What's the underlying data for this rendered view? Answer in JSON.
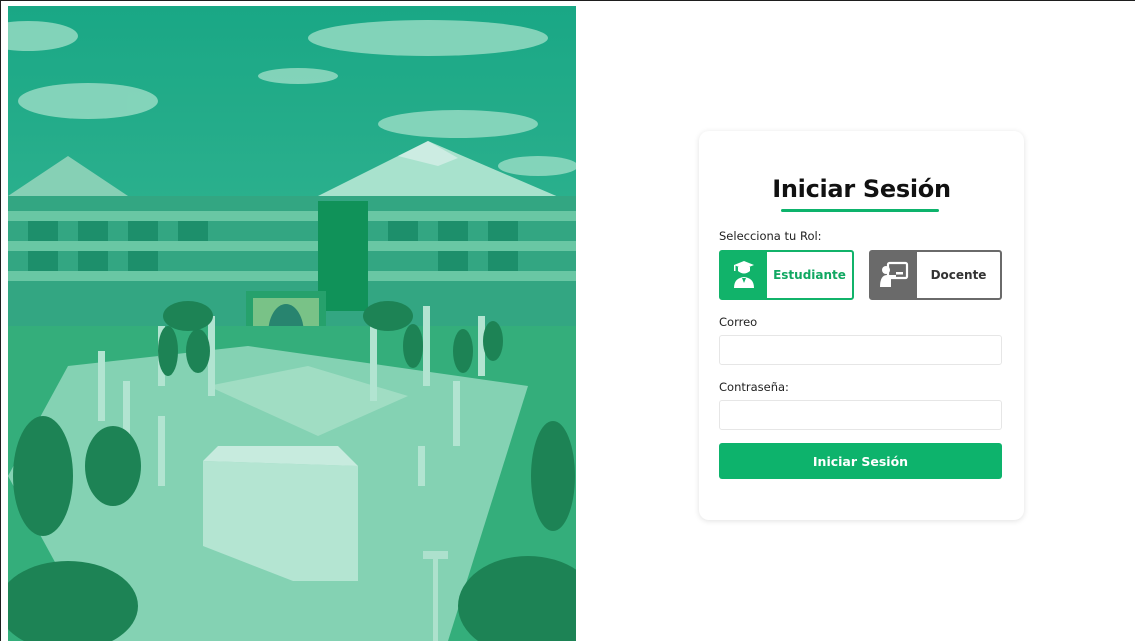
{
  "login": {
    "title": "Iniciar Sesión",
    "role_label": "Selecciona tu Rol:",
    "roles": [
      {
        "label": "Estudiante",
        "icon": "graduate-icon",
        "selected": true
      },
      {
        "label": "Docente",
        "icon": "teacher-board-icon",
        "selected": false
      }
    ],
    "email_label": "Correo",
    "email_value": "",
    "password_label": "Contraseña:",
    "password_value": "",
    "submit_label": "Iniciar Sesión"
  },
  "colors": {
    "accent": "#0db36c",
    "photo_tint": "#1fb07a",
    "inactive_role": "#6a6a6a"
  }
}
